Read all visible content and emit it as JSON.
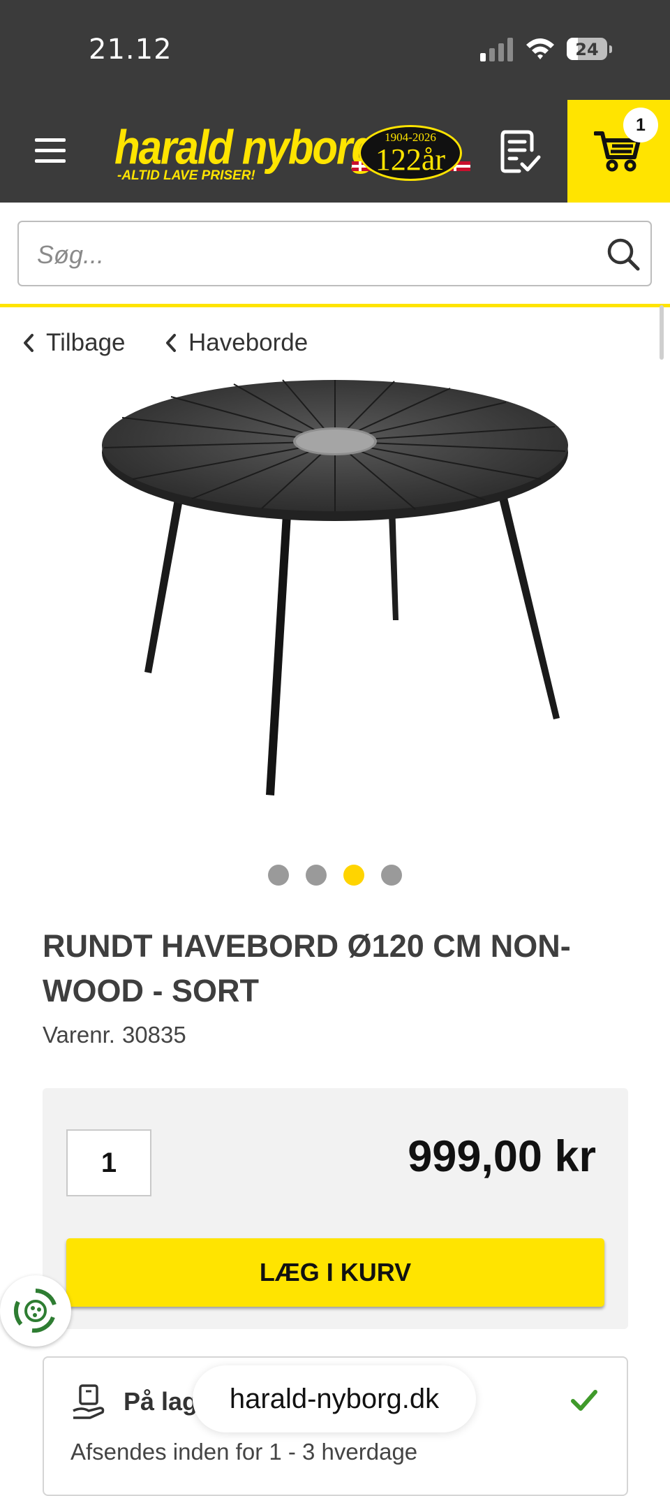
{
  "status_bar": {
    "time": "21.12",
    "battery": "24"
  },
  "header": {
    "logo_text": "harald nyborg",
    "logo_slogan": "-ALTID LAVE PRISER!",
    "badge_years": "1904-2026",
    "badge_main": "122år",
    "cart_count": "1"
  },
  "search": {
    "placeholder": "Søg..."
  },
  "breadcrumb": {
    "back_label": "Tilbage",
    "category_label": "Haveborde"
  },
  "gallery": {
    "image_count": 4,
    "active_index": 2
  },
  "product": {
    "title": "RUNDT HAVEBORD Ø120 CM NON-WOOD - SORT",
    "sku_label": "Varenr.",
    "sku": "30835",
    "quantity": "1",
    "price": "999,00 kr",
    "add_to_cart_label": "LÆG I KURV"
  },
  "stock": {
    "label": "På lag",
    "subtitle": "Afsendes inden for 1 - 3 hverdage"
  },
  "browser": {
    "url": "harald-nyborg.dk"
  },
  "colors": {
    "brand_yellow": "#ffe400",
    "header_dark": "#3b3b3b",
    "check_green": "#3f9a2a"
  }
}
